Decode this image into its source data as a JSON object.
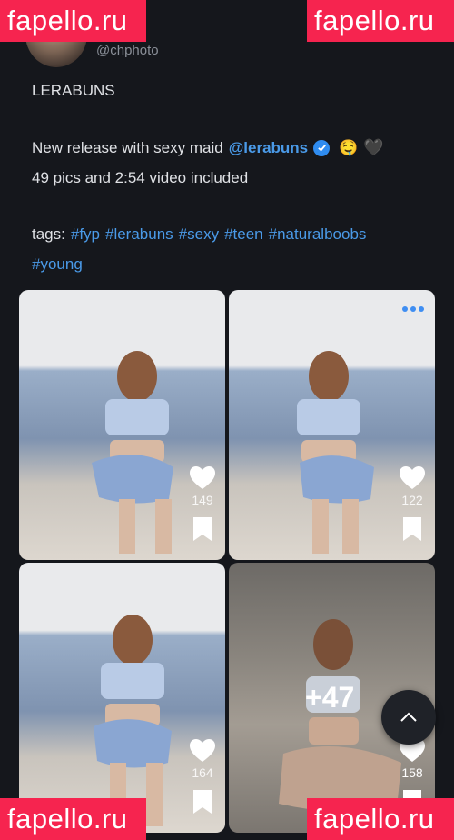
{
  "profile": {
    "name": "",
    "handle": "@chphoto"
  },
  "post": {
    "title": "LERABUNS",
    "release_prefix": "New release with sexy maid",
    "mention": "@lerabuns",
    "emoji_face": "🤤",
    "emoji_heart": "🖤",
    "content_line": "49 pics and 2:54 video included",
    "tags_label": "tags:",
    "tags_row1": [
      "#fyp",
      "#lerabuns",
      "#sexy",
      "#teen",
      "#naturalboobs"
    ],
    "tags_row2": [
      "#young"
    ]
  },
  "gallery": {
    "tiles": [
      {
        "likes": "149"
      },
      {
        "likes": "122"
      },
      {
        "likes": "164"
      },
      {
        "likes": "158",
        "more_label": "+47"
      }
    ]
  },
  "watermark": {
    "text": "fapello.ru"
  },
  "colors": {
    "background": "#15171c",
    "link": "#4a9ae8",
    "verified": "#2f8cf0",
    "watermark": "#f6244f"
  }
}
